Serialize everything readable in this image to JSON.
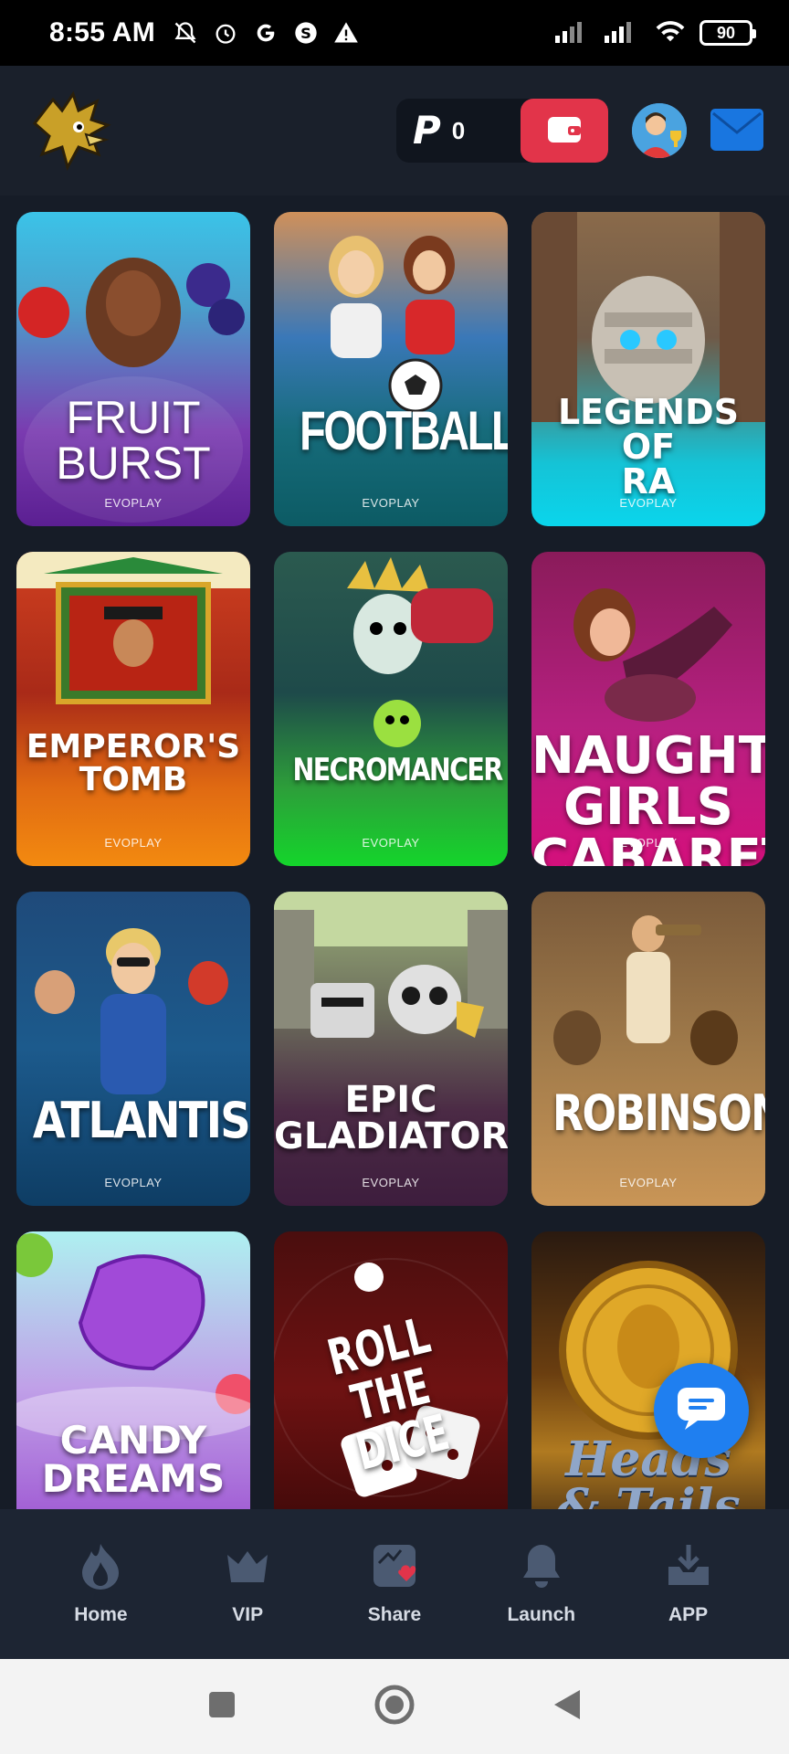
{
  "status_bar": {
    "time": "8:55 AM",
    "battery": "90"
  },
  "header": {
    "balance": "0",
    "colors": {
      "wallet": "#e2344a",
      "mail": "#1976e0"
    }
  },
  "games": [
    {
      "title": "FRUIT\nBURST",
      "provider": "EVOPLAY",
      "bg": "linear-gradient(180deg,#3bc3e8 0%,#4aa0cc 30%,#7a3bb0 70%,#5b1f92 100%)"
    },
    {
      "title": "FOOTBALL",
      "provider": "EVOPLAY",
      "bg": "linear-gradient(180deg,#d0905a 0%,#3a78b8 40%,#166b7a 70%,#0c5b64 100%)"
    },
    {
      "title": "LEGENDS\nOF\nRA",
      "provider": "EVOPLAY",
      "bg": "linear-gradient(180deg,#8a6a4a 0%,#6f5a48 40%,#15c3d6 80%,#0ad5ec 100%)"
    },
    {
      "title": "EMPEROR'S\nTOMB",
      "provider": "EVOPLAY",
      "bg": "linear-gradient(180deg,#d04020 0%,#a92a18 45%,#e06a12 75%,#f38a10 100%)"
    },
    {
      "title": "NECROMANCER",
      "provider": "EVOPLAY",
      "bg": "linear-gradient(180deg,#2b5a4f 0%,#1e4a4a 45%,#2d9e3a 75%,#14d52b 100%)"
    },
    {
      "title": "NAUGHTY\nGIRLS\nCABARET",
      "provider": "EVOPLAY",
      "bg": "linear-gradient(180deg,#8a1b5a 0%,#b62080 55%,#d4107c 100%)"
    },
    {
      "title": "ATLANTIS",
      "provider": "EVOPLAY",
      "bg": "linear-gradient(180deg,#1f4a7a 0%,#1c5a8c 50%,#0e3d64 100%)"
    },
    {
      "title": "EPIC\nGLADIATORS",
      "provider": "EVOPLAY",
      "bg": "linear-gradient(180deg,#9ab07a 0%,#6a6a5a 40%,#4b2a45 70%,#3d1d3d 100%)"
    },
    {
      "title": "ROBINSON",
      "provider": "EVOPLAY",
      "bg": "linear-gradient(180deg,#7a5a3a 0%,#a07a4a 50%,#c99556 100%)"
    },
    {
      "title": "CANDY\nDREAMS",
      "provider": "",
      "bg": "linear-gradient(180deg,#aef0f0 0%,#c0a0e8 50%,#9a4ed0 100%)"
    },
    {
      "title": "ROLL THE DICE",
      "provider": "",
      "bg": "linear-gradient(180deg,#4a0e0e 0%,#6e1212 50%,#3a0808 100%)"
    },
    {
      "title": "Heads\n& Tails",
      "provider": "",
      "bg": "linear-gradient(180deg,#2a1a10 0%,#6a3e10 45%,#b07a20 70%,#3a2410 100%)"
    }
  ],
  "nav": [
    {
      "label": "Home",
      "icon": "flame-icon"
    },
    {
      "label": "VIP",
      "icon": "crown-icon"
    },
    {
      "label": "Share",
      "icon": "share-gift-icon"
    },
    {
      "label": "Launch",
      "icon": "bell-icon"
    },
    {
      "label": "APP",
      "icon": "download-icon"
    }
  ]
}
